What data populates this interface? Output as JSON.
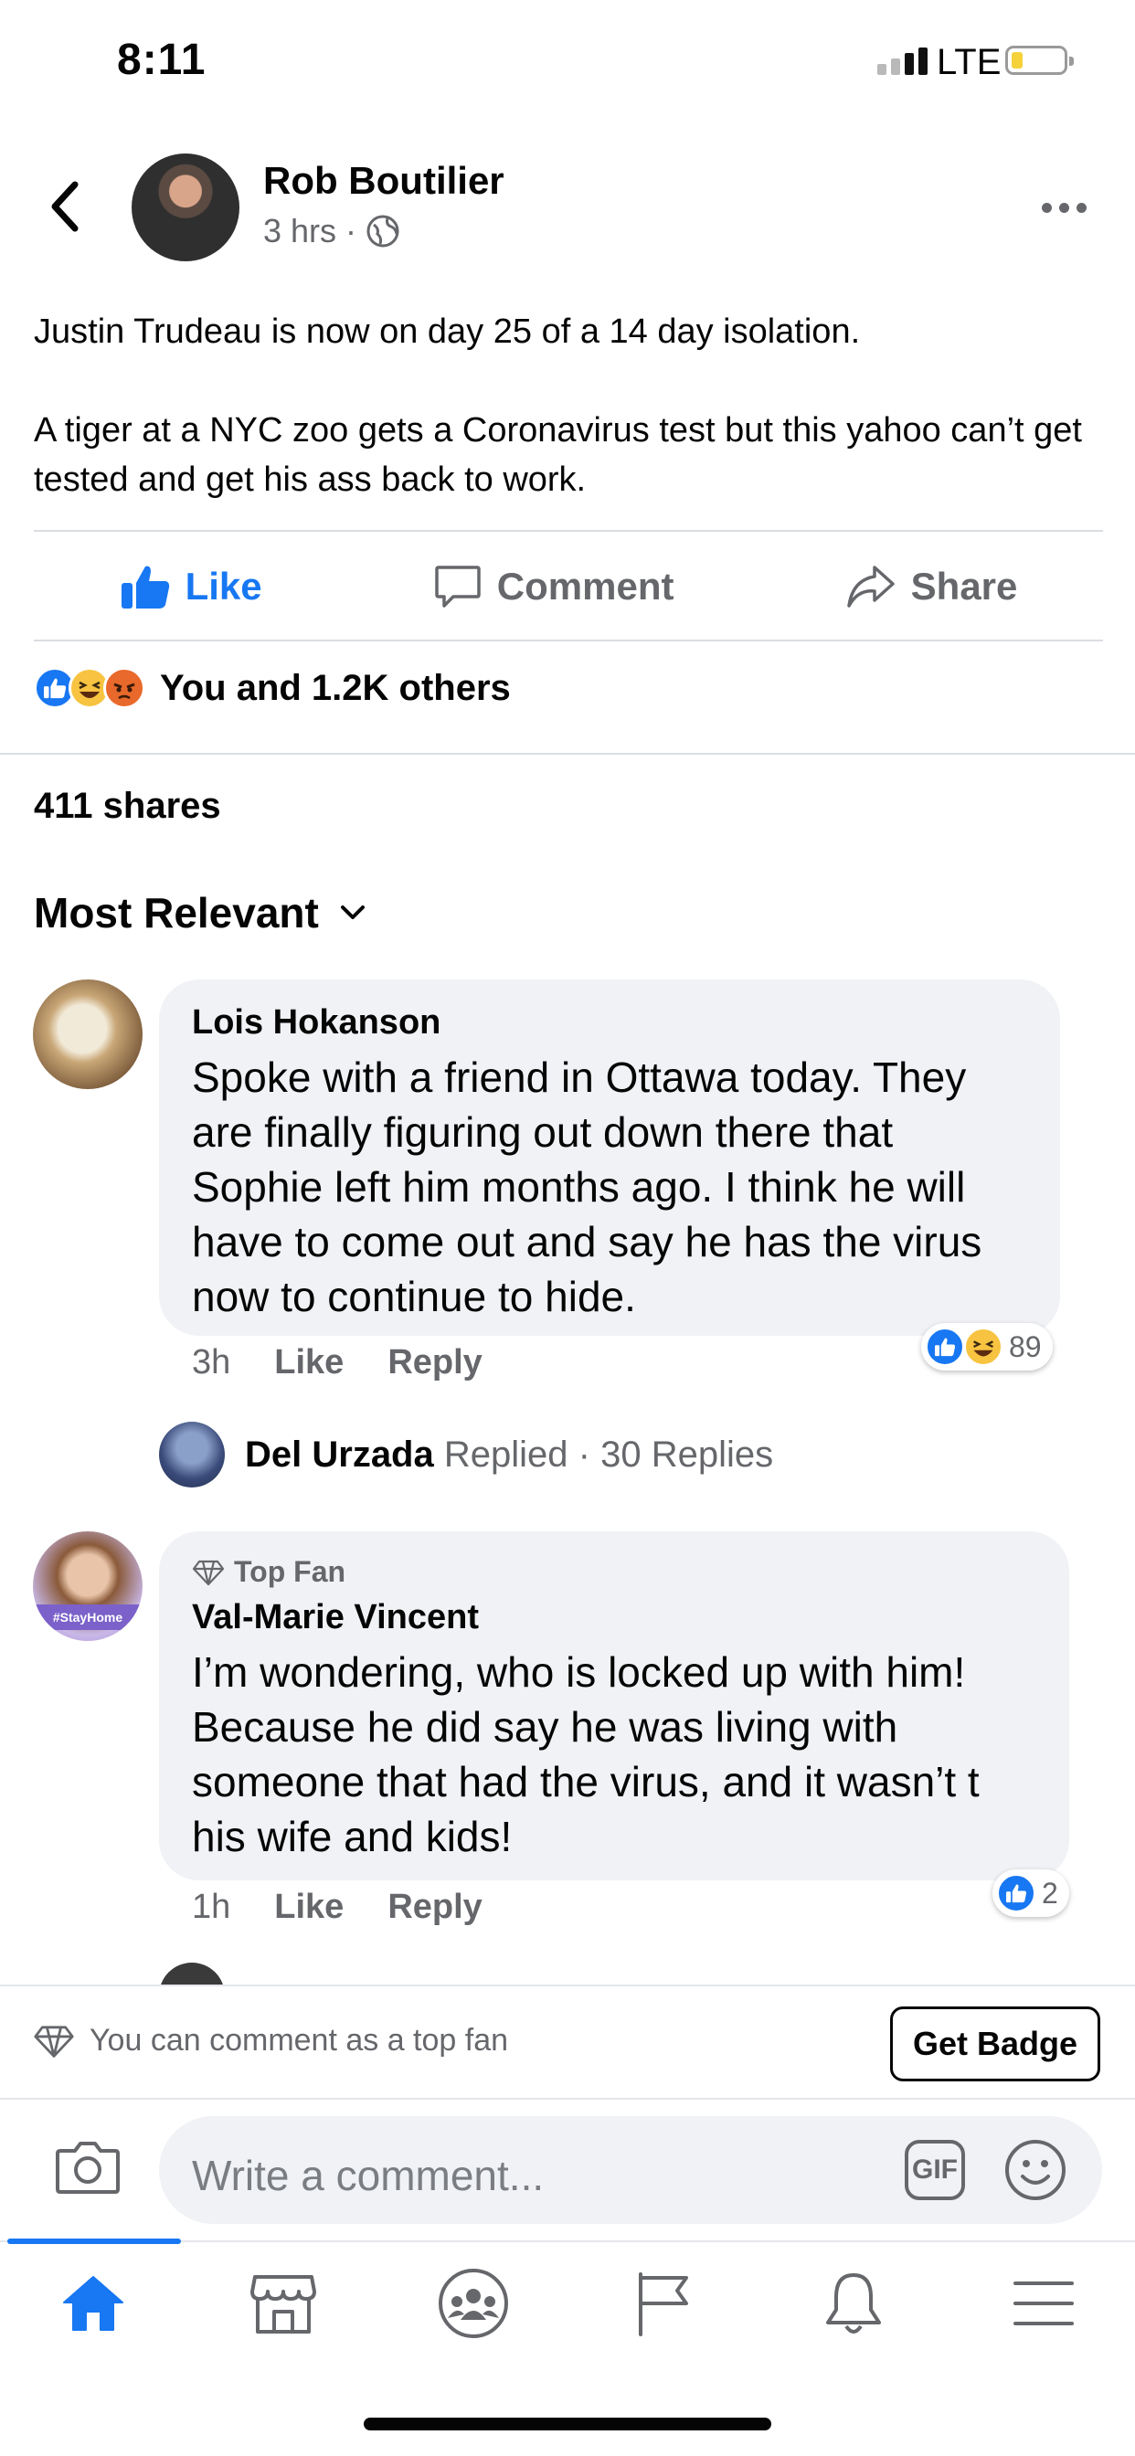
{
  "status_bar": {
    "time": "8:11",
    "network": "LTE",
    "signal_bars": 4,
    "signal_bars_active": 2,
    "battery_level": 0.15,
    "battery_color": "#f5d23a"
  },
  "post": {
    "author": "Rob Boutilier",
    "time": "3 hrs",
    "separator": "·",
    "paragraphs": [
      "Justin Trudeau is now on day 25 of a 14 day isolation.",
      "A tiger at a NYC zoo gets a Coronavirus test but this yahoo can’t get tested and get his ass back to work."
    ],
    "actions": {
      "like": "Like",
      "comment": "Comment",
      "share": "Share"
    },
    "reactions_summary": "You and 1.2K others",
    "shares": "411 shares"
  },
  "comments_header": {
    "sort_label": "Most Relevant"
  },
  "comments": [
    {
      "name": "Lois Hokanson",
      "text": "Spoke with a friend in Ottawa today. They are finally figuring out down there that Sophie left him months ago. I think he will have to come out and say he has the virus now to continue to hide.",
      "time": "3h",
      "like_label": "Like",
      "reply_label": "Reply",
      "reaction_count": "89",
      "reply_preview": {
        "name": "Del Urzada",
        "action": "Replied",
        "separator": "·",
        "count": "30 Replies"
      }
    },
    {
      "badge": "Top Fan",
      "name": "Val-Marie Vincent",
      "text": "I’m wondering, who is locked up with him! Because he did say he was living with someone that had the virus, and it wasn’t t his wife and kids!",
      "time": "1h",
      "like_label": "Like",
      "reply_label": "Reply",
      "reaction_count": "2",
      "avatar_caption": "#StayHome"
    }
  ],
  "top_fan_bar": {
    "note": "You can comment as a top fan",
    "button": "Get Badge"
  },
  "composer": {
    "placeholder": "Write a comment...",
    "gif_label": "GIF"
  },
  "tab_bar": {
    "tabs": [
      "home-icon",
      "marketplace-icon",
      "groups-icon",
      "pages-icon",
      "notifications-icon",
      "menu-icon"
    ],
    "active_tab": "home-icon"
  },
  "colors": {
    "accent": "#1877f2",
    "secondary_text": "#65676b",
    "bubble": "#f0f2f5"
  }
}
